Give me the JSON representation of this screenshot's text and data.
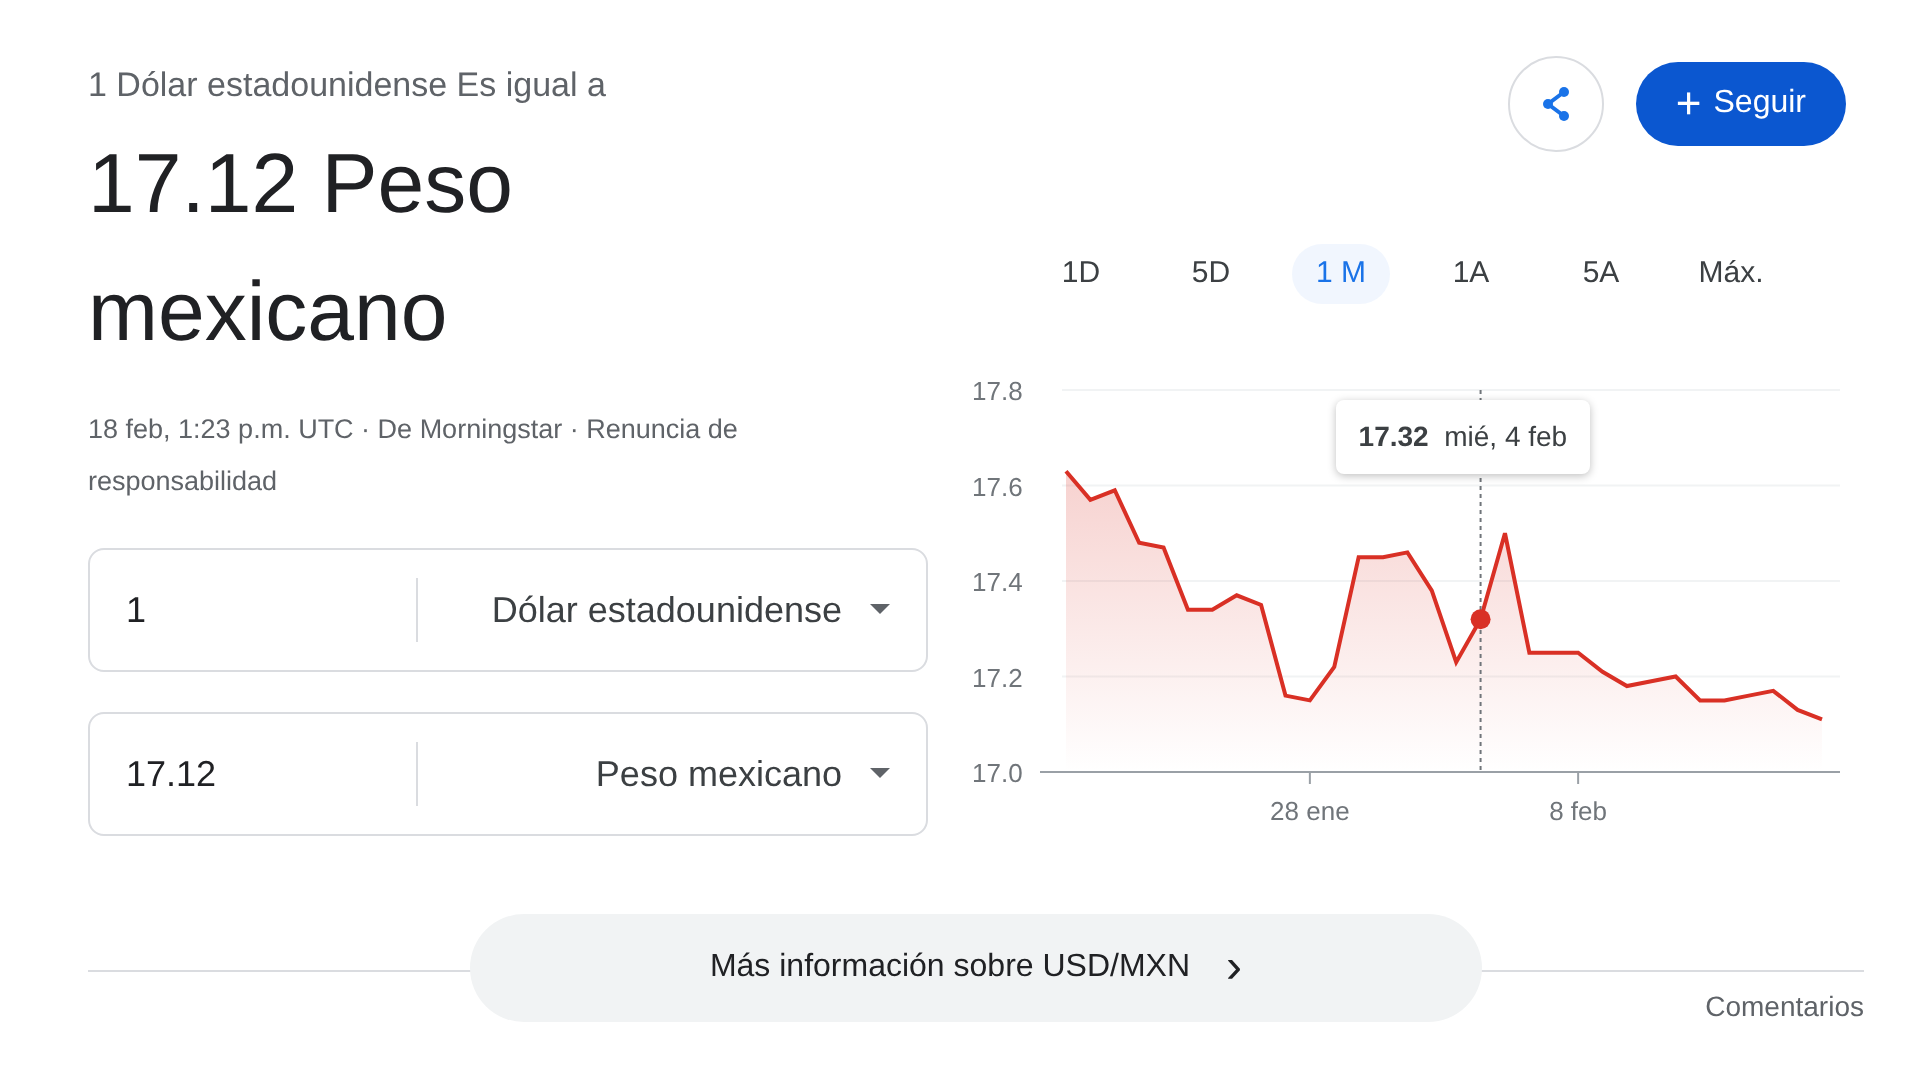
{
  "header": {
    "subtitle": "1 Dólar estadounidense Es igual a",
    "result": "17.12 Peso mexicano",
    "meta": "18 feb, 1:23 p.m. UTC · De Morningstar · Renuncia de responsabilidad"
  },
  "actions": {
    "follow": "Seguir",
    "follow_icon": "+"
  },
  "converter": [
    {
      "amount": "1",
      "currency": "Dólar estadounidense"
    },
    {
      "amount": "17.12",
      "currency": "Peso mexicano"
    }
  ],
  "ranges": [
    {
      "label": "1D",
      "selected": false
    },
    {
      "label": "5D",
      "selected": false
    },
    {
      "label": "1 M",
      "selected": true
    },
    {
      "label": "1A",
      "selected": false
    },
    {
      "label": "5A",
      "selected": false
    },
    {
      "label": "Máx.",
      "selected": false
    }
  ],
  "chart_data": {
    "type": "area",
    "categories": [
      null,
      null,
      null,
      null,
      null,
      null,
      null,
      null,
      null,
      null,
      "28 ene",
      null,
      null,
      null,
      null,
      null,
      null,
      null,
      null,
      null,
      null,
      "8 feb",
      null,
      null,
      null,
      null,
      null,
      null,
      null,
      null,
      null,
      null
    ],
    "series": [
      {
        "color": "#d93025",
        "values": [
          17.63,
          17.57,
          17.59,
          17.48,
          17.47,
          17.34,
          17.34,
          17.37,
          17.35,
          17.16,
          17.15,
          17.22,
          17.45,
          17.45,
          17.46,
          17.38,
          17.23,
          17.32,
          17.5,
          17.25,
          17.25,
          17.25,
          17.21,
          17.18,
          17.19,
          17.2,
          17.15,
          17.15,
          17.16,
          17.17,
          17.13,
          17.11
        ]
      }
    ],
    "ylim": [
      17.0,
      17.8
    ],
    "yticks": [
      {
        "value": 17.0,
        "label": "17.0"
      },
      {
        "value": 17.2,
        "label": "17.2"
      },
      {
        "value": 17.4,
        "label": "17.4"
      },
      {
        "value": 17.6,
        "label": "17.6"
      },
      {
        "value": 17.8,
        "label": "17.8"
      }
    ],
    "grid": true,
    "annotations": [
      "**17.32**  mié, 4 feb"
    ]
  },
  "more_info": {
    "label": "Más información sobre USD/MXN",
    "icon": "›"
  },
  "feedback": "Comentarios"
}
